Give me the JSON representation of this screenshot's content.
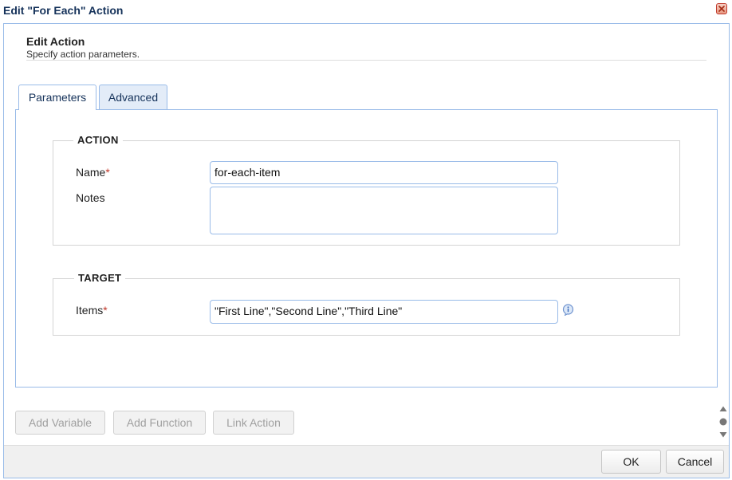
{
  "window": {
    "title": "Edit \"For Each\" Action",
    "close_icon": "close-icon"
  },
  "header": {
    "title": "Edit Action",
    "subtitle": "Specify action parameters."
  },
  "tabs": [
    {
      "label": "Parameters",
      "active": true
    },
    {
      "label": "Advanced",
      "active": false
    }
  ],
  "action_section": {
    "legend": "ACTION",
    "name_label": "Name",
    "name_value": "for-each-item",
    "notes_label": "Notes",
    "notes_value": ""
  },
  "target_section": {
    "legend": "TARGET",
    "items_label": "Items",
    "items_value": "\"First Line\",\"Second Line\",\"Third Line\"",
    "info_icon": "info-icon"
  },
  "required_marker": "*",
  "toolbar": {
    "add_variable": "Add Variable",
    "add_function": "Add Function",
    "link_action": "Link Action"
  },
  "footer": {
    "ok": "OK",
    "cancel": "Cancel"
  },
  "colors": {
    "accent": "#99bbe8",
    "title": "#15325a",
    "required": "#c0392b"
  }
}
